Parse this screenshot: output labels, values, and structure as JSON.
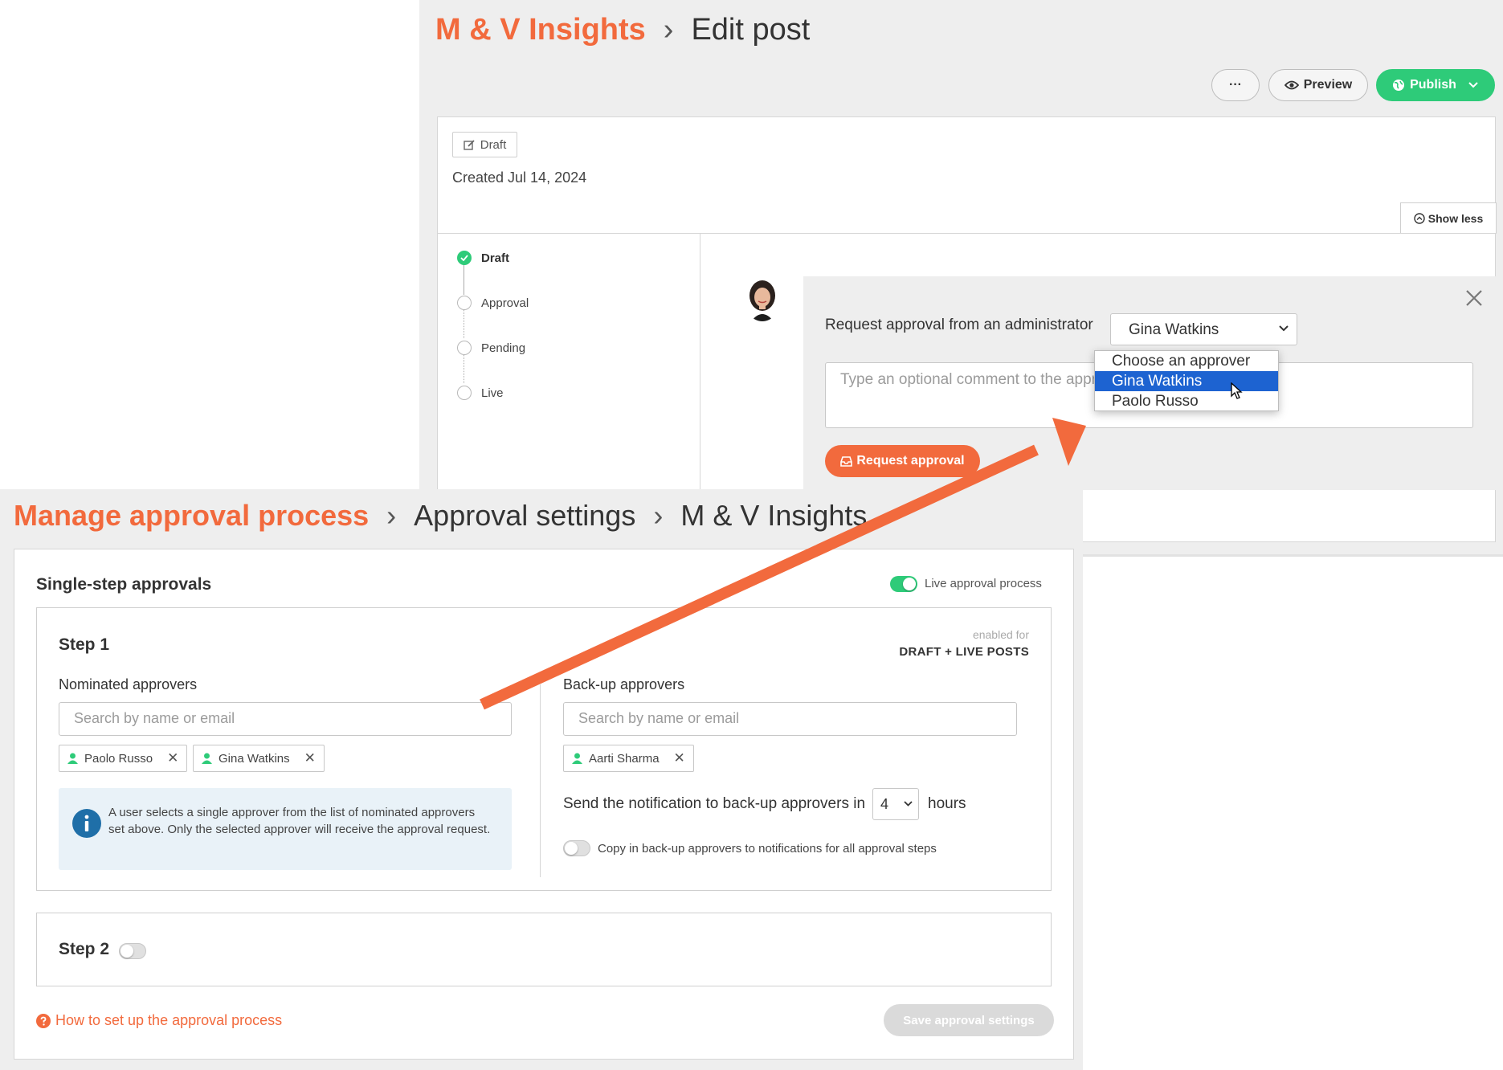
{
  "edit_post": {
    "breadcrumb": {
      "site": "M & V Insights",
      "page": "Edit post",
      "separator": "›"
    },
    "toolbar": {
      "more_label": "···",
      "preview_label": "Preview",
      "publish_label": "Publish"
    },
    "status_badge": "Draft",
    "created": "Created Jul 14, 2024",
    "show_less_label": "Show less",
    "workflow_steps": [
      {
        "label": "Draft",
        "done": true
      },
      {
        "label": "Approval",
        "done": false
      },
      {
        "label": "Pending",
        "done": false
      },
      {
        "label": "Live",
        "done": false
      }
    ],
    "request": {
      "label": "Request approval from an administrator",
      "selected_approver": "Gina Watkins",
      "comment_placeholder": "Type an optional comment to the approver",
      "button_label": "Request approval",
      "dropdown_options": [
        "Choose an approver",
        "Gina Watkins",
        "Paolo Russo"
      ],
      "dropdown_selected": "Gina Watkins"
    }
  },
  "approval_settings": {
    "breadcrumb": {
      "root": "Manage approval process",
      "middle": "Approval settings",
      "current": "M & V Insights",
      "separator": "›"
    },
    "section_title": "Single-step approvals",
    "live_toggle": {
      "label": "Live approval process",
      "on": true
    },
    "step1": {
      "title": "Step 1",
      "enabled_for_label": "enabled for",
      "enabled_for_value": "DRAFT + LIVE POSTS",
      "nominated": {
        "label": "Nominated approvers",
        "placeholder": "Search by name or email",
        "chips": [
          "Paolo Russo",
          "Gina Watkins"
        ]
      },
      "backup": {
        "label": "Back-up approvers",
        "placeholder": "Search by name or email",
        "chips": [
          "Aarti Sharma"
        ]
      },
      "info_text": "A user selects a single approver from the list of nominated approvers set above. Only the selected approver will receive the approval request.",
      "notify_label": "Send the notification to back-up approvers in",
      "notify_hours": "4",
      "hours_label": "hours",
      "copy_label": "Copy in back-up approvers to notifications for all approval steps",
      "copy_on": false
    },
    "step2": {
      "title": "Step 2",
      "on": false
    },
    "help_link": "How to set up the approval process",
    "save_label": "Save approval settings"
  },
  "colors": {
    "accent": "#f26a3d",
    "success": "#2ecb79",
    "selected": "#1d63d1",
    "info_bg": "#e9f2f8"
  },
  "icons": [
    "pencil-square-icon",
    "eye-icon",
    "globe-icon",
    "chevron-down-icon",
    "check-icon",
    "close-icon",
    "inbox-icon",
    "user-icon",
    "info-icon",
    "question-circle-icon",
    "chevron-up-circle-icon",
    "cursor-icon"
  ]
}
